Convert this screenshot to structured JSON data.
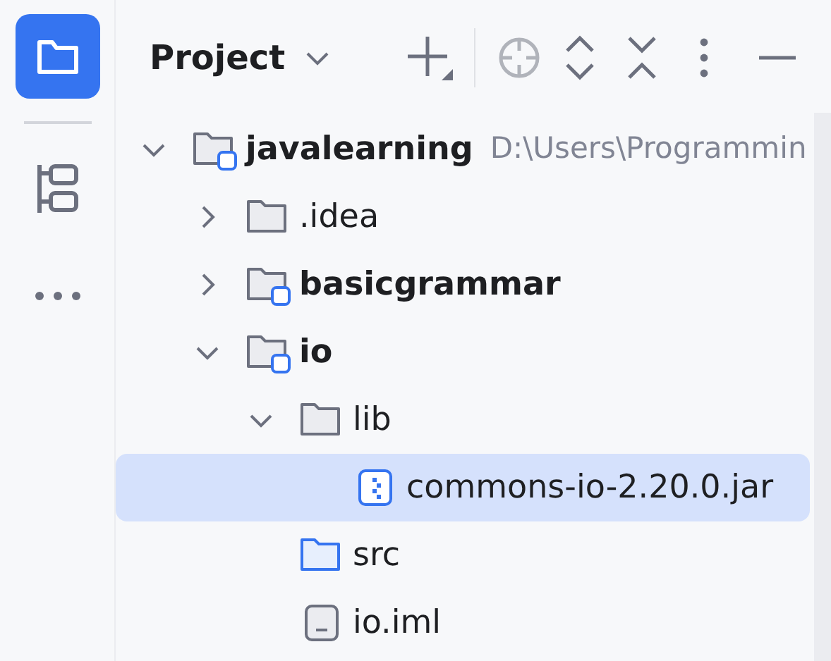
{
  "toolstrip": [
    {
      "kind": "project",
      "selected": true
    },
    {
      "kind": "structure",
      "selected": false
    },
    {
      "kind": "more",
      "selected": false
    }
  ],
  "panel": {
    "title": "Project"
  },
  "tree": [
    {
      "name": "javalearning",
      "kind": "module",
      "path": "D:\\Users\\Programmin",
      "expanded": true,
      "selected": false,
      "children": [
        {
          "name": ".idea",
          "kind": "folder",
          "expanded": false,
          "selected": false
        },
        {
          "name": "basicgrammar",
          "kind": "module",
          "expanded": false,
          "selected": false
        },
        {
          "name": "io",
          "kind": "module",
          "expanded": true,
          "selected": false,
          "children": [
            {
              "name": "lib",
              "kind": "folder",
              "expanded": true,
              "selected": false,
              "children": [
                {
                  "name": "commons-io-2.20.0.jar",
                  "kind": "jar",
                  "selected": true
                }
              ]
            },
            {
              "name": "src",
              "kind": "source",
              "selected": false
            },
            {
              "name": "io.iml",
              "kind": "iml",
              "selected": false
            }
          ]
        }
      ]
    }
  ]
}
